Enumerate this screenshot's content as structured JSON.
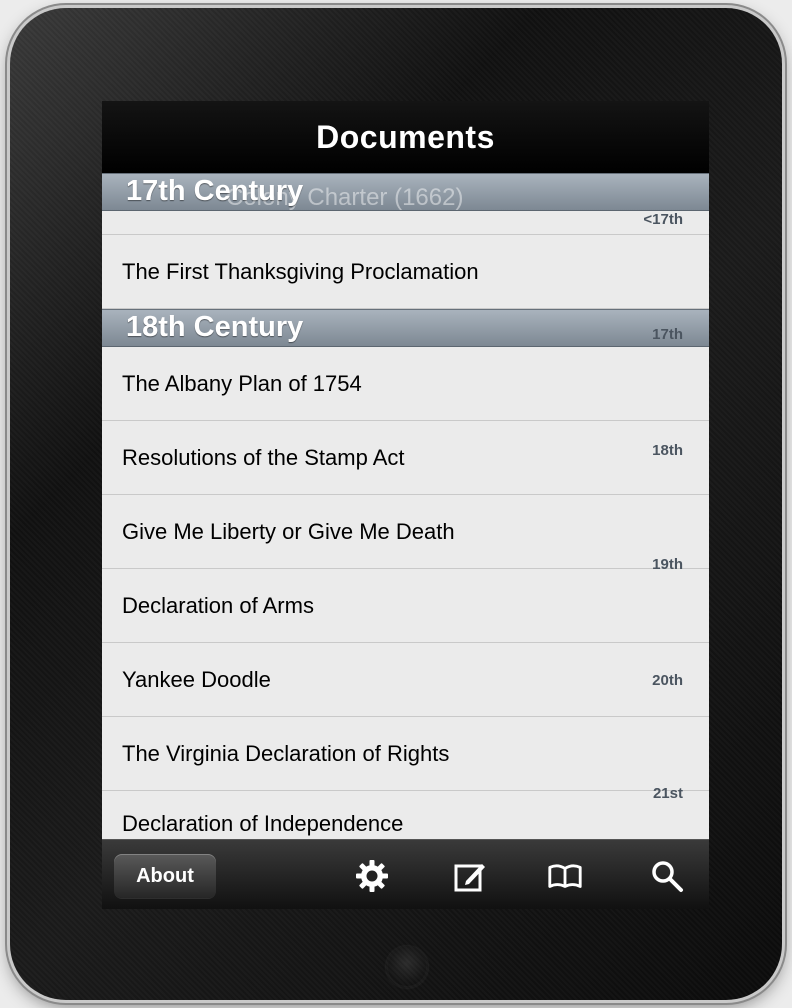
{
  "nav": {
    "title": "Documents"
  },
  "sections": [
    {
      "title": "17th Century",
      "ghost_text": "Colony Charter (1662)"
    },
    {
      "title": "18th Century"
    }
  ],
  "rows": [
    {
      "label": "The First Thanksgiving Proclamation"
    },
    {
      "label": "The Albany Plan of 1754"
    },
    {
      "label": "Resolutions of the Stamp Act"
    },
    {
      "label": "Give Me Liberty or Give Me Death"
    },
    {
      "label": "Declaration of Arms"
    },
    {
      "label": "Yankee Doodle"
    },
    {
      "label": "The Virginia Declaration of Rights"
    },
    {
      "label": "Declaration of Independence"
    }
  ],
  "index": [
    "<17th",
    "17th",
    "18th",
    "19th",
    "20th",
    "21st"
  ],
  "tabbar": {
    "about_label": "About",
    "icons": [
      "gear-icon",
      "compose-icon",
      "book-icon",
      "search-icon"
    ]
  },
  "colors": {
    "nav_bg": "#000000",
    "section_header": "#8c97a2",
    "list_bg": "#ebebeb",
    "index_text": "#4b5560"
  }
}
